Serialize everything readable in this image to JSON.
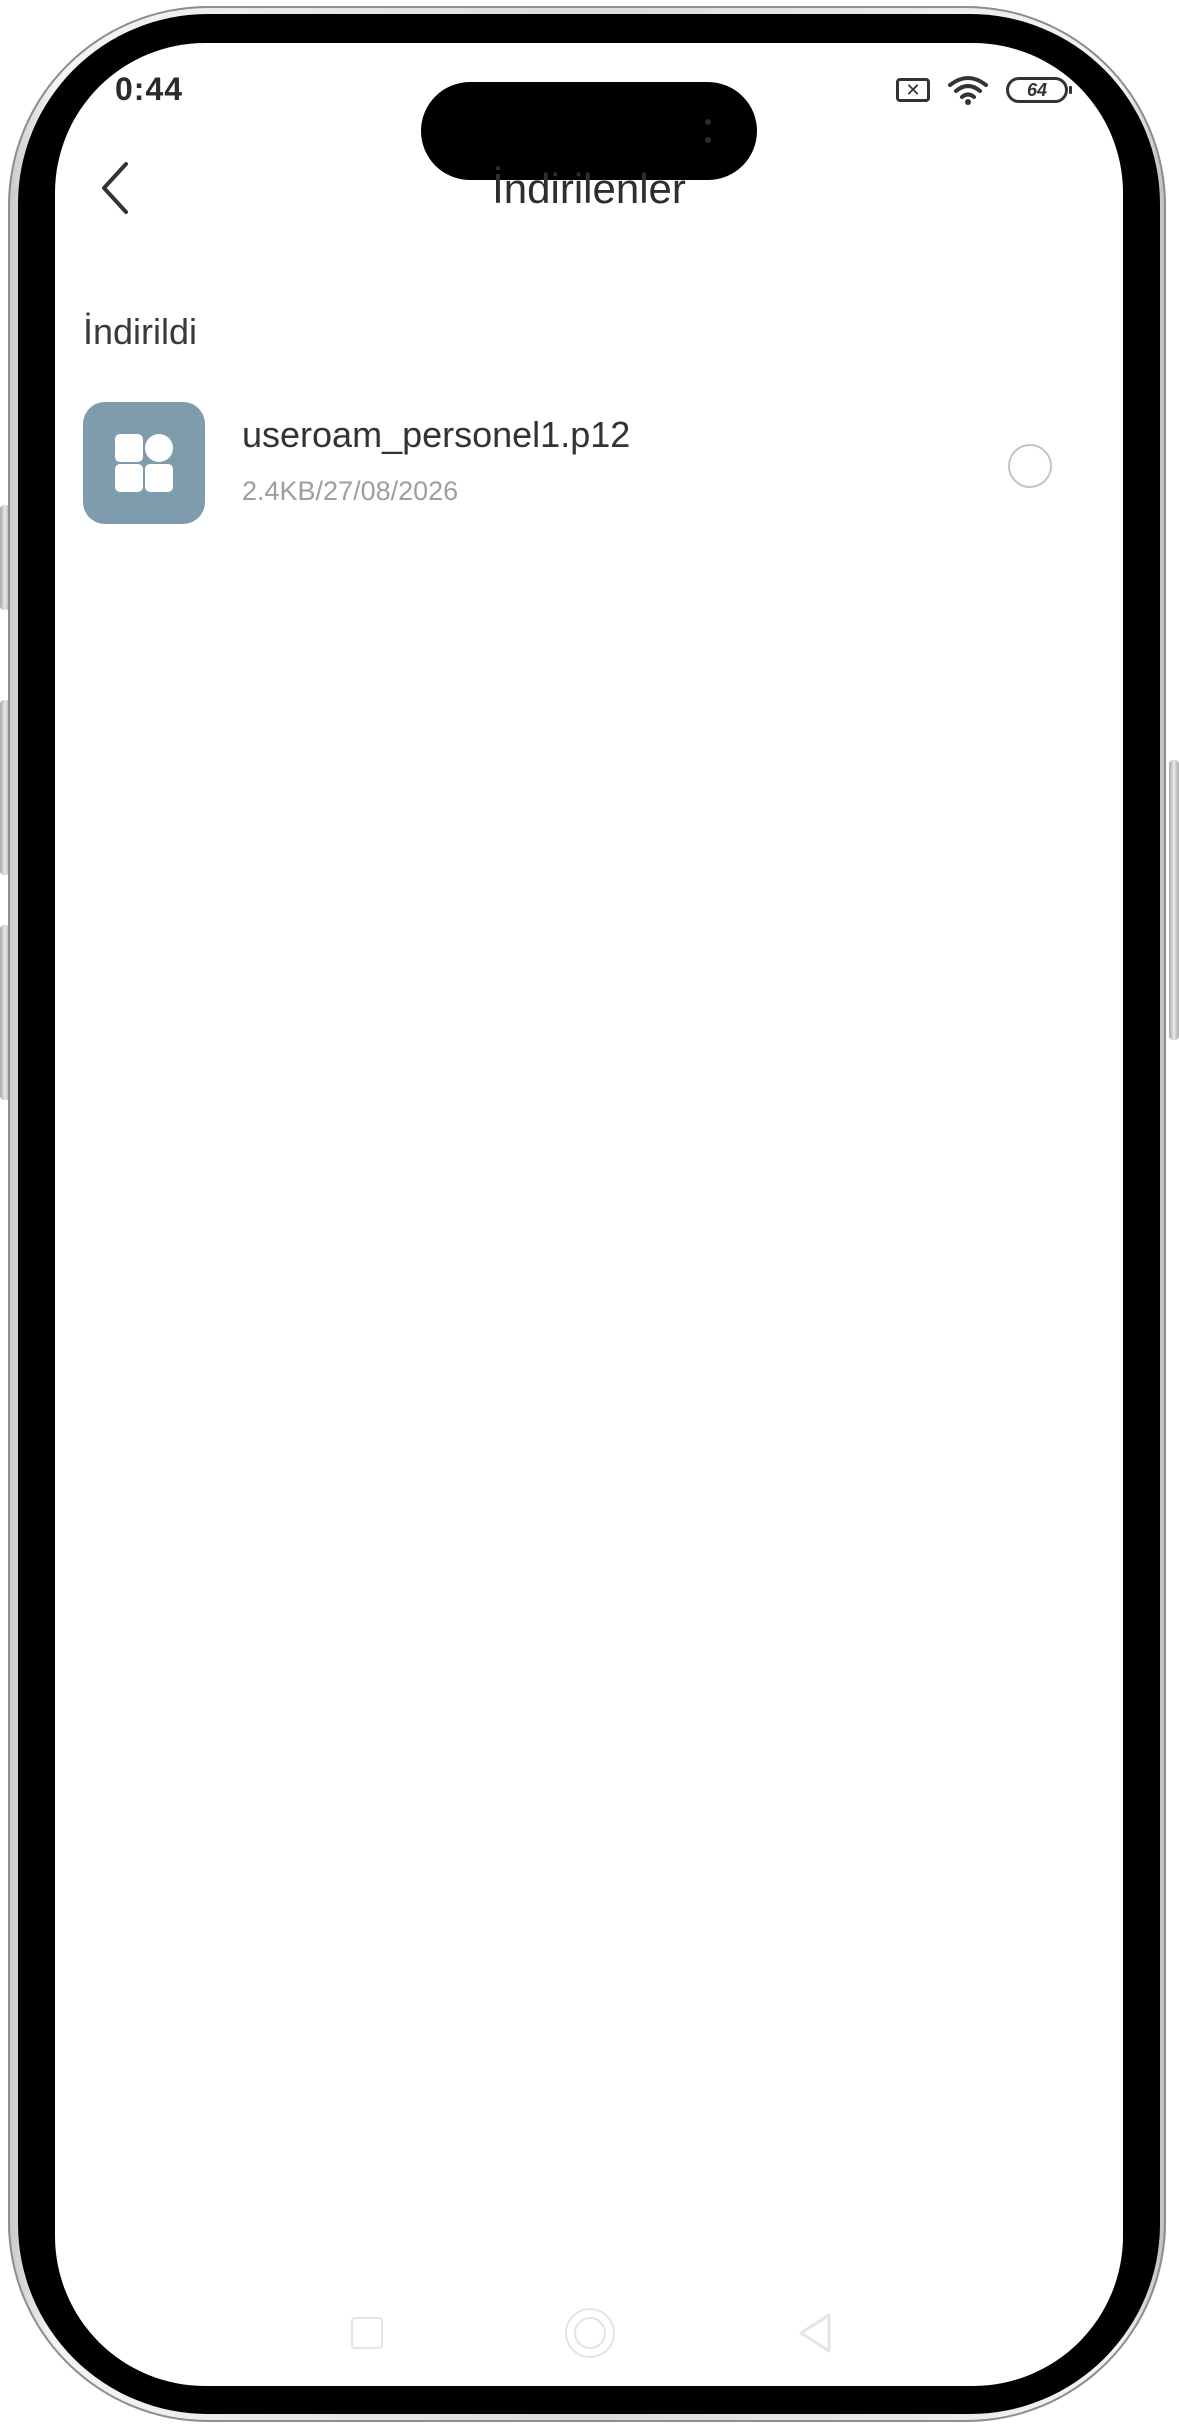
{
  "status_bar": {
    "time": "0:44",
    "sim_icon": "sim-x-icon",
    "wifi_icon": "wifi-icon",
    "battery_level": "64"
  },
  "header": {
    "back_icon": "chevron-left-icon",
    "title": "İndirilenler"
  },
  "section": {
    "label": "İndirildi"
  },
  "files": [
    {
      "icon": "app-grid-icon",
      "name": "useroam_personel1.p12",
      "meta": "2.4KB/27/08/2026",
      "selected": false
    }
  ],
  "nav_bar": {
    "recents_icon": "square-icon",
    "home_icon": "circle-icon",
    "back_icon": "triangle-back-icon"
  },
  "colors": {
    "file_icon_bg": "#7f9cad",
    "title_text": "#2e2e2e",
    "meta_text": "#9e9e9e"
  }
}
